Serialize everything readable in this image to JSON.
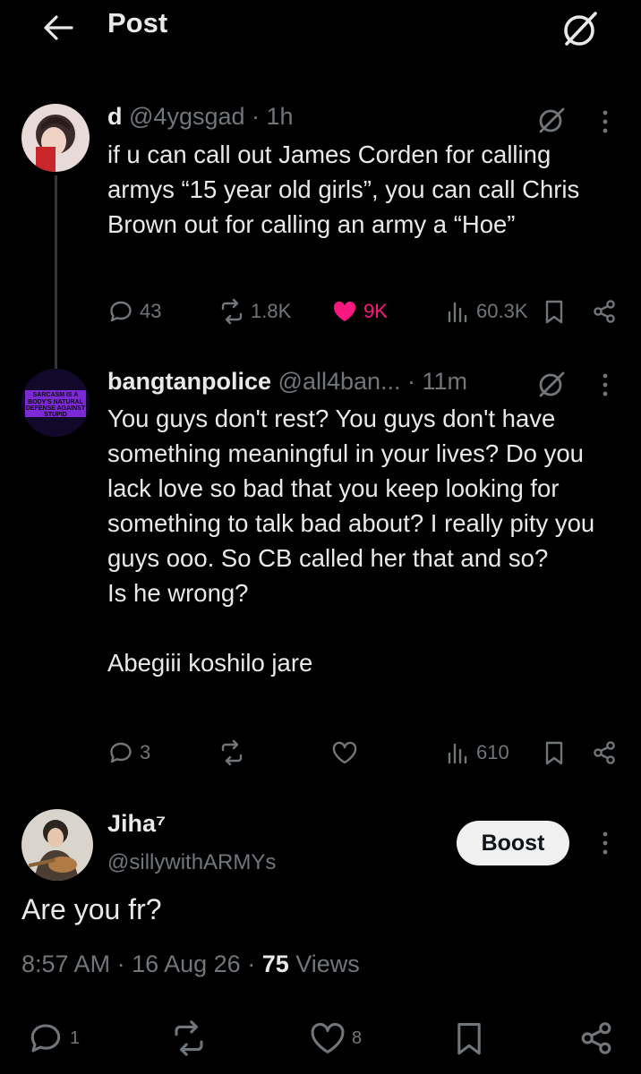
{
  "header": {
    "title": "Post"
  },
  "tweets": [
    {
      "name": "d",
      "handle": "@4ygsgad",
      "time": "1h",
      "text": "if u can call out James Corden for calling armys “15 year old girls”, you can call Chris Brown out for calling an army a “Hoe”",
      "replies": "43",
      "reposts": "1.8K",
      "likes": "9K",
      "views": "60.3K",
      "liked": true
    },
    {
      "name": "bangtanpolice",
      "handle": "@all4ban...",
      "time": "11m",
      "avatar_text": "SARCASM IS A BODY'S NATURAL DEFENSE AGAINST STUPID",
      "text": "You guys don't rest? You guys don't have something meaningful in your lives? Do you lack love so bad that you keep looking for something to talk bad about? I really pity you guys ooo. So CB called her that and so?\nIs he wrong?\n\nAbegiii koshilo jare",
      "replies": "3",
      "reposts": "",
      "likes": "",
      "views": "610",
      "liked": false
    }
  ],
  "main_post": {
    "name": "Jiha⁷",
    "handle": "@sillywithARMYs",
    "boost_label": "Boost",
    "text": "Are you fr?",
    "time": "8:57 AM",
    "date": "16 Aug 26",
    "views_count": "75",
    "views_label": "Views",
    "replies": "1",
    "likes": "8"
  },
  "colors": {
    "background": "#000000",
    "text": "#e7e9ea",
    "muted": "#71767b",
    "like": "#f91880"
  },
  "icons": [
    "back-arrow-icon",
    "grok-icon",
    "more-icon",
    "reply-icon",
    "repost-icon",
    "heart-icon",
    "views-icon",
    "bookmark-icon",
    "share-icon"
  ]
}
